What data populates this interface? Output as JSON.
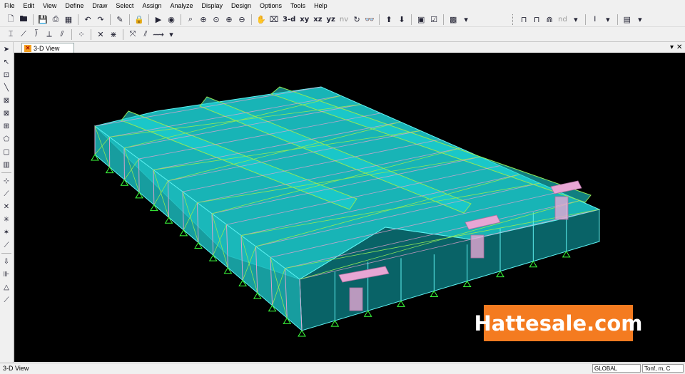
{
  "menu": [
    "File",
    "Edit",
    "View",
    "Define",
    "Draw",
    "Select",
    "Assign",
    "Analyze",
    "Display",
    "Design",
    "Options",
    "Tools",
    "Help"
  ],
  "toolbar1": {
    "view_3d": "3-d",
    "view_xy": "xy",
    "view_xz": "xz",
    "view_yz": "yz",
    "view_nv": "nv",
    "nd_label": "nd"
  },
  "tab": {
    "label": "3-D View"
  },
  "status": {
    "text": "3-D View",
    "coord_system": "GLOBAL",
    "units": "Tonf, m, C"
  },
  "watermark": "Hattesale.com",
  "colors": {
    "viewport_bg": "#000000",
    "roof_fill": "#1cd3d6",
    "frame_cyan": "#5ef2f2",
    "frame_green": "#8ee85a",
    "frame_pink": "#e9a3d0",
    "support_green": "#3cff3c",
    "opening": "#e7a6d4",
    "watermark_bg": "#f47b20"
  }
}
